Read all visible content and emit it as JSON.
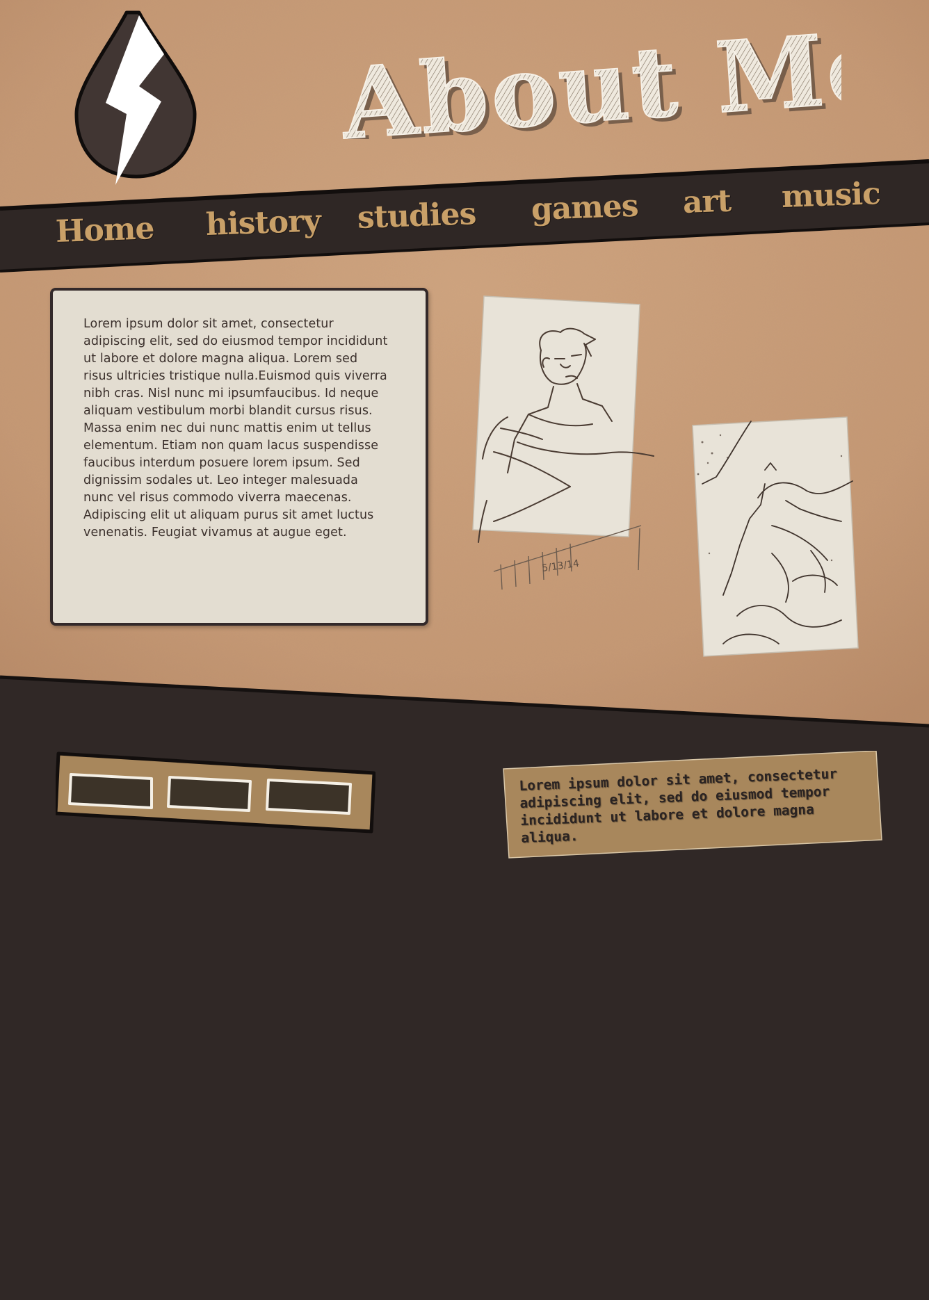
{
  "header": {
    "title": "About Me,"
  },
  "nav": {
    "items": [
      {
        "label": "Home"
      },
      {
        "label": "history"
      },
      {
        "label": "studies"
      },
      {
        "label": "games"
      },
      {
        "label": "art"
      },
      {
        "label": "music"
      }
    ]
  },
  "main": {
    "bio_text": "Lorem ipsum dolor sit amet, consectetur adipiscing elit, sed do eiusmod tempor incididunt ut labore et dolore magna aliqua. Lorem sed risus ultricies tristique nulla.Euismod quis viverra nibh cras. Nisl nunc mi ipsumfaucibus. Id neque aliquam vestibulum morbi blandit cursus risus. Massa enim nec dui nunc mattis enim ut tellus elementum. Etiam non quam lacus suspendisse faucibus interdum posuere lorem ipsum. Sed dignissim sodales ut. Leo integer malesuada nunc vel risus commodo viverra maecenas. Adipiscing elit ut aliquam purus sit amet luctus venenatis. Feugiat vivamus at augue eget."
  },
  "footer": {
    "note_text": "Lorem ipsum dolor sit amet, consectetur adipiscing elit, sed do eiusmod tempor incididunt ut labore et dolore magna aliqua."
  },
  "sketch_1": {
    "signature": "5/13/14"
  },
  "colors": {
    "paper": "#c89c78",
    "dark": "#302826",
    "nav_text": "#c9a068",
    "card": "#e3ddd1",
    "strip": "#a8875c"
  },
  "icons": {
    "logo": "lightning-drop-icon"
  }
}
